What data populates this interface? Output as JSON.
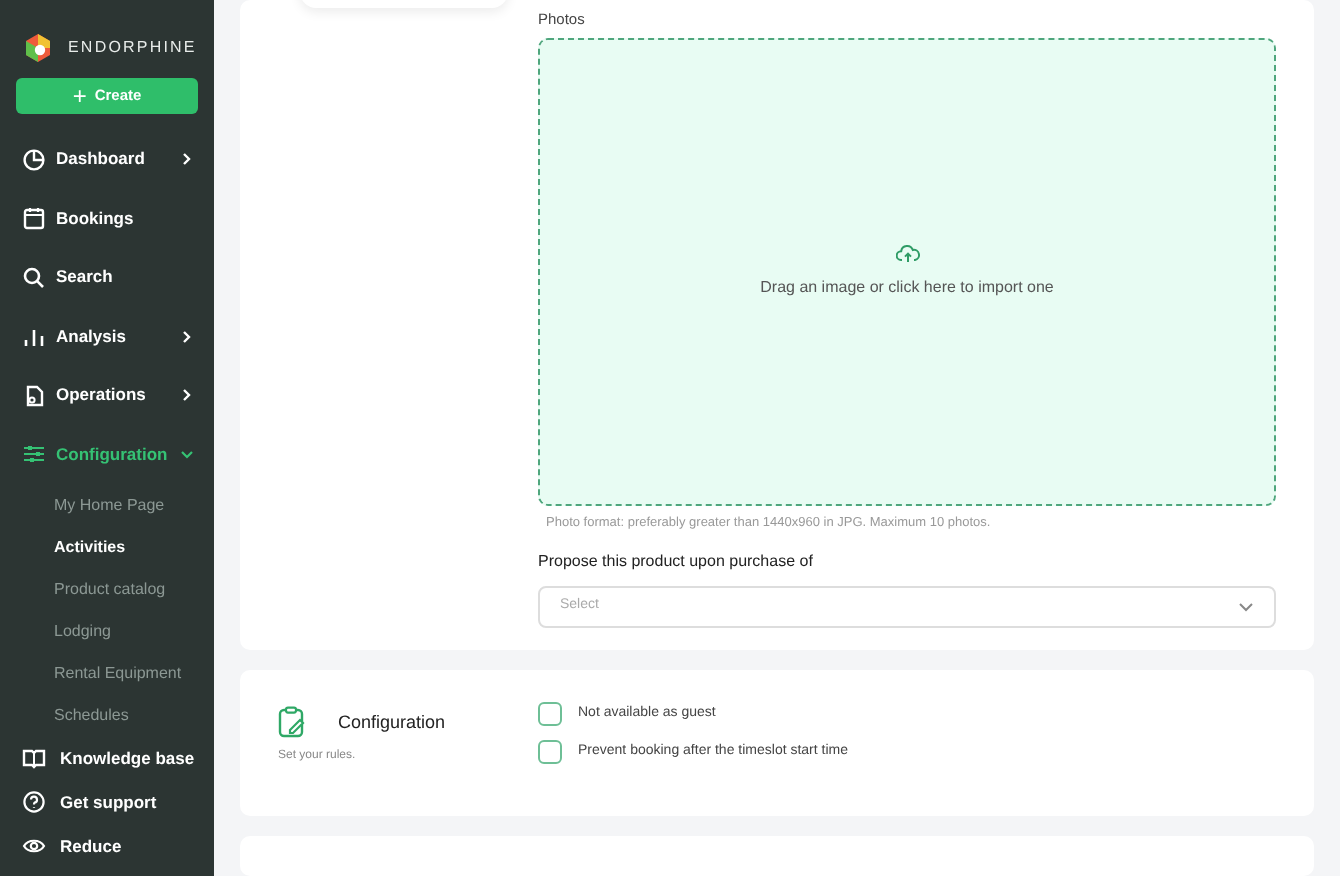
{
  "brand": {
    "name": "ENDORPHINE"
  },
  "create_button": {
    "label": "Create",
    "icon": "+"
  },
  "sidebar": {
    "items": [
      {
        "label": "Dashboard",
        "expanded": false,
        "selected": false
      },
      {
        "label": "Bookings",
        "selected": false
      },
      {
        "label": "Search",
        "selected": false
      },
      {
        "label": "Analysis",
        "expanded": false,
        "selected": false
      },
      {
        "label": "Operations",
        "expanded": false,
        "selected": false
      },
      {
        "label": "Configuration",
        "expanded": true,
        "selected": true,
        "children": [
          {
            "label": "My Home Page",
            "selected": false
          },
          {
            "label": "Activities",
            "selected": true
          },
          {
            "label": "Product catalog",
            "selected": false
          },
          {
            "label": "Lodging",
            "selected": false
          },
          {
            "label": "Rental Equipment",
            "selected": false
          },
          {
            "label": "Schedules",
            "selected": false
          }
        ]
      }
    ],
    "footer_items": [
      {
        "label": "Knowledge base"
      },
      {
        "label": "Get support"
      },
      {
        "label": "Reduce"
      }
    ]
  },
  "photos": {
    "label": "Photos",
    "dropzone_text": "Drag an image or click here to import one",
    "hint": "Photo format: preferably greater than 1440x960 in JPG. Maximum 10 photos."
  },
  "propose": {
    "label": "Propose this product upon purchase of",
    "placeholder": "Select"
  },
  "configuration": {
    "title": "Configuration",
    "subtitle": "Set your rules.",
    "options": [
      {
        "label": "Not available as guest",
        "checked": false
      },
      {
        "label": "Prevent booking after the timeslot start time",
        "checked": false
      }
    ]
  }
}
